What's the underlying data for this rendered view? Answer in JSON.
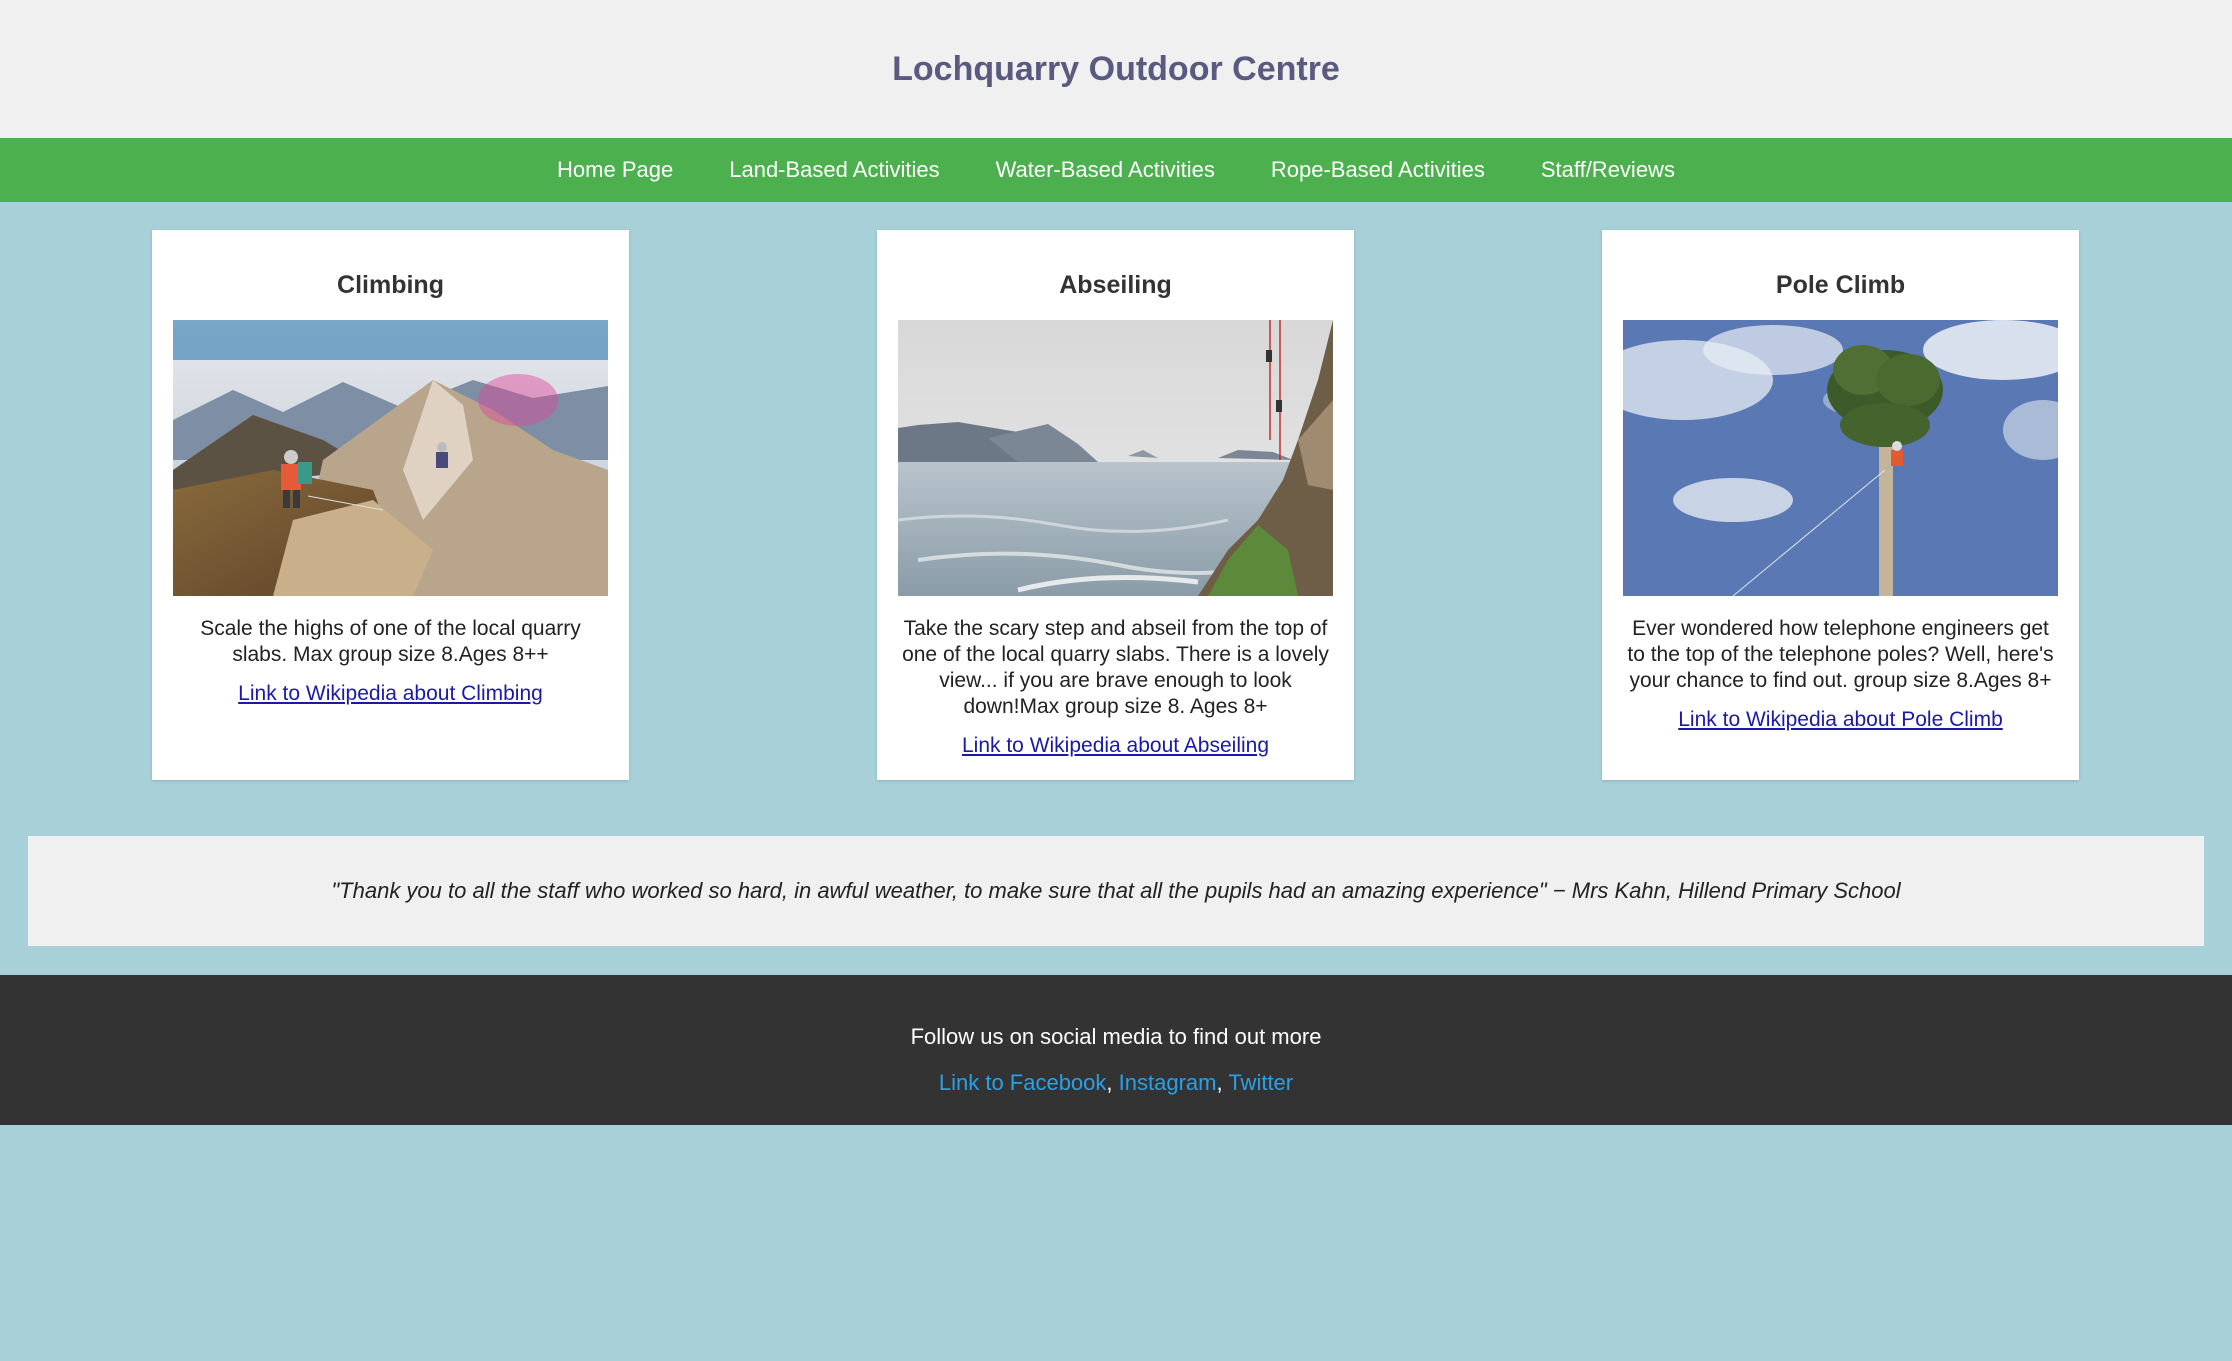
{
  "site": {
    "title": "Lochquarry Outdoor Centre"
  },
  "nav": {
    "items": [
      {
        "label": "Home Page"
      },
      {
        "label": "Land-Based Activities"
      },
      {
        "label": "Water-Based Activities"
      },
      {
        "label": "Rope-Based Activities"
      },
      {
        "label": "Staff/Reviews"
      }
    ]
  },
  "cards": [
    {
      "title": "Climbing",
      "description": "Scale the highs of one of the local quarry slabs. Max group size 8.Ages 8++",
      "link": "Link to Wikipedia about Climbing",
      "image": "climbers-on-mountain-ridge"
    },
    {
      "title": "Abseiling",
      "description": "Take the scary step and abseil from the top of one of the local quarry slabs. There is a lovely view... if you are brave enough to look down!Max group size 8. Ages 8+",
      "link": "Link to Wikipedia about Abseiling",
      "image": "abseilers-on-sea-cliff"
    },
    {
      "title": "Pole Climb",
      "description": "Ever wondered how telephone engineers get to the top of the telephone poles? Well, here's your chance to find out. group size 8.Ages 8+",
      "link": "Link to Wikipedia about Pole Climb",
      "image": "climber-on-tall-pole"
    }
  ],
  "testimonial": {
    "text": "\"Thank you to all the staff who worked so hard, in awful weather, to make sure that all the pupils had an amazing experience\" − Mrs Kahn, Hillend Primary School"
  },
  "footer": {
    "follow": "Follow us on social media to find out more",
    "links": [
      {
        "label": "Link to Facebook"
      },
      {
        "label": "Instagram"
      },
      {
        "label": "Twitter"
      }
    ],
    "separator": ","
  },
  "colors": {
    "page_bg": "#a8d0d8",
    "header_bg": "#f0f0f0",
    "nav_bg": "#4cb04f",
    "footer_bg": "#333333",
    "footer_link": "#2aa0e8",
    "card_link": "#1a1aa6"
  }
}
